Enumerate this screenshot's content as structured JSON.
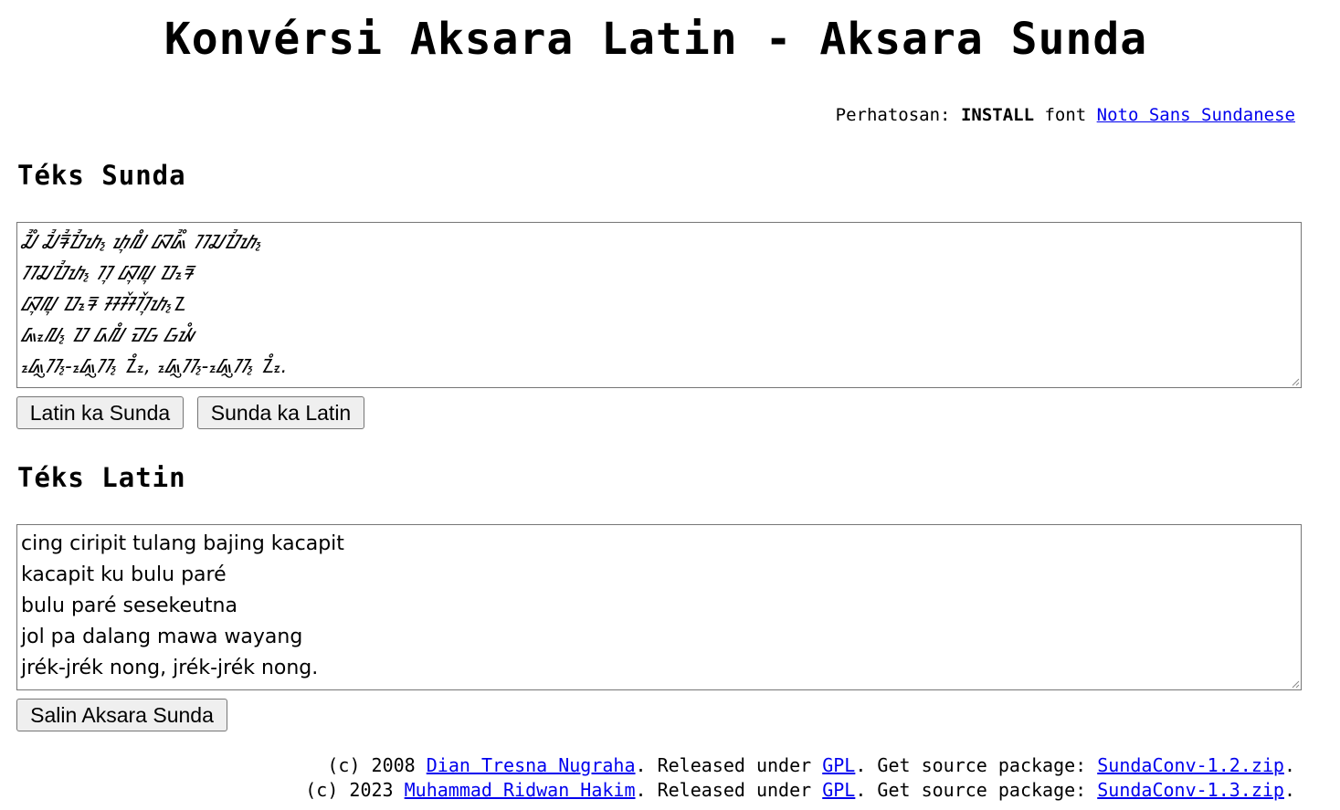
{
  "title": "Konvérsi Aksara Latin - Aksara Sunda",
  "notice": {
    "prefix": "Perhatosan: ",
    "install": "INSTALL",
    "middle": " font ",
    "font_link": "Noto Sans Sundanese"
  },
  "sunda_section": {
    "heading": "Téks Sunda",
    "lines": [
      "ᮎᮤᮀ ᮎᮤᮛᮤᮕᮤᮒ᮪ ᮒᮥᮜᮀ ᮘᮏᮤᮀ ᮊᮎᮕᮤᮒ᮪",
      "ᮊᮎᮕᮤᮒ᮪ ᮊᮥ ᮘᮥᮜᮥ ᮕᮛᮦ",
      "ᮘᮥᮜᮥ ᮕᮛᮦ ᮞᮞᮨᮊᮨᮥᮒ᮪ᮔ",
      "ᮏᮧᮜ᮪ ᮕ ᮓᮜᮀ ᮙᮝ ᮝᮚᮀ",
      "ᮏᮢᮦᮊ᮪-ᮏᮢᮦᮊ᮪ ᮔᮧᮀ, ᮏᮢᮦᮊ᮪-ᮏᮢᮦᮊ᮪ ᮔᮧᮀ."
    ]
  },
  "buttons": {
    "latin_to_sunda": "Latin ka Sunda",
    "sunda_to_latin": "Sunda ka Latin",
    "copy_sunda": "Salin Aksara Sunda"
  },
  "latin_section": {
    "heading": "Téks Latin",
    "lines": [
      "cing ciripit tulang bajing kacapit",
      "kacapit ku bulu paré",
      "bulu paré sesekeutna",
      "jol pa dalang mawa wayang",
      "jrék-jrék nong, jrék-jrék nong."
    ]
  },
  "footer": [
    {
      "prefix": "(c) 2008 ",
      "author": "Dian Tresna Nugraha",
      "released": ". Released under ",
      "license": "GPL",
      "source": ". Get source package: ",
      "package": "SundaConv-1.2.zip",
      "end": "."
    },
    {
      "prefix": "(c) 2023 ",
      "author": "Muhammad Ridwan Hakim",
      "released": ". Released under ",
      "license": "GPL",
      "source": ". Get source package: ",
      "package": "SundaConv-1.3.zip",
      "end": "."
    }
  ],
  "colors": {
    "link": "#0000ee",
    "button_bg": "#efefef",
    "border": "#767676"
  }
}
